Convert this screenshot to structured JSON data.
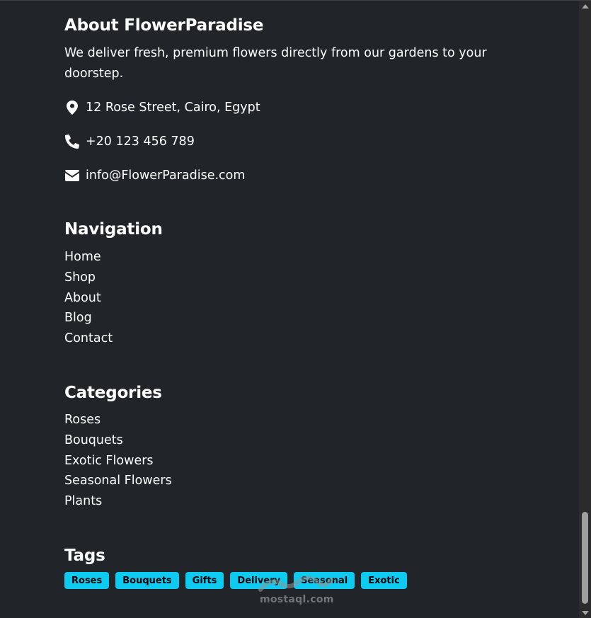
{
  "about": {
    "title": "About FlowerParadise",
    "description": "We deliver fresh, premium flowers directly from our gardens to your doorstep.",
    "address": "12 Rose Street, Cairo, Egypt",
    "phone": "+20 123 456 789",
    "email": "info@FlowerParadise.com",
    "icons": [
      "map-marker-icon",
      "phone-icon",
      "envelope-icon"
    ]
  },
  "navigation": {
    "title": "Navigation",
    "items": [
      "Home",
      "Shop",
      "About",
      "Blog",
      "Contact"
    ]
  },
  "categories": {
    "title": "Categories",
    "items": [
      "Roses",
      "Bouquets",
      "Exotic Flowers",
      "Seasonal Flowers",
      "Plants"
    ]
  },
  "tags": {
    "title": "Tags",
    "items": [
      "Roses",
      "Bouquets",
      "Gifts",
      "Delivery",
      "Seasonal",
      "Exotic"
    ]
  },
  "watermark": {
    "text": "mostaql.com"
  },
  "colors": {
    "background": "#212529",
    "text": "#ffffff",
    "tag_background": "#0dcaf0",
    "tag_text": "#000000"
  }
}
